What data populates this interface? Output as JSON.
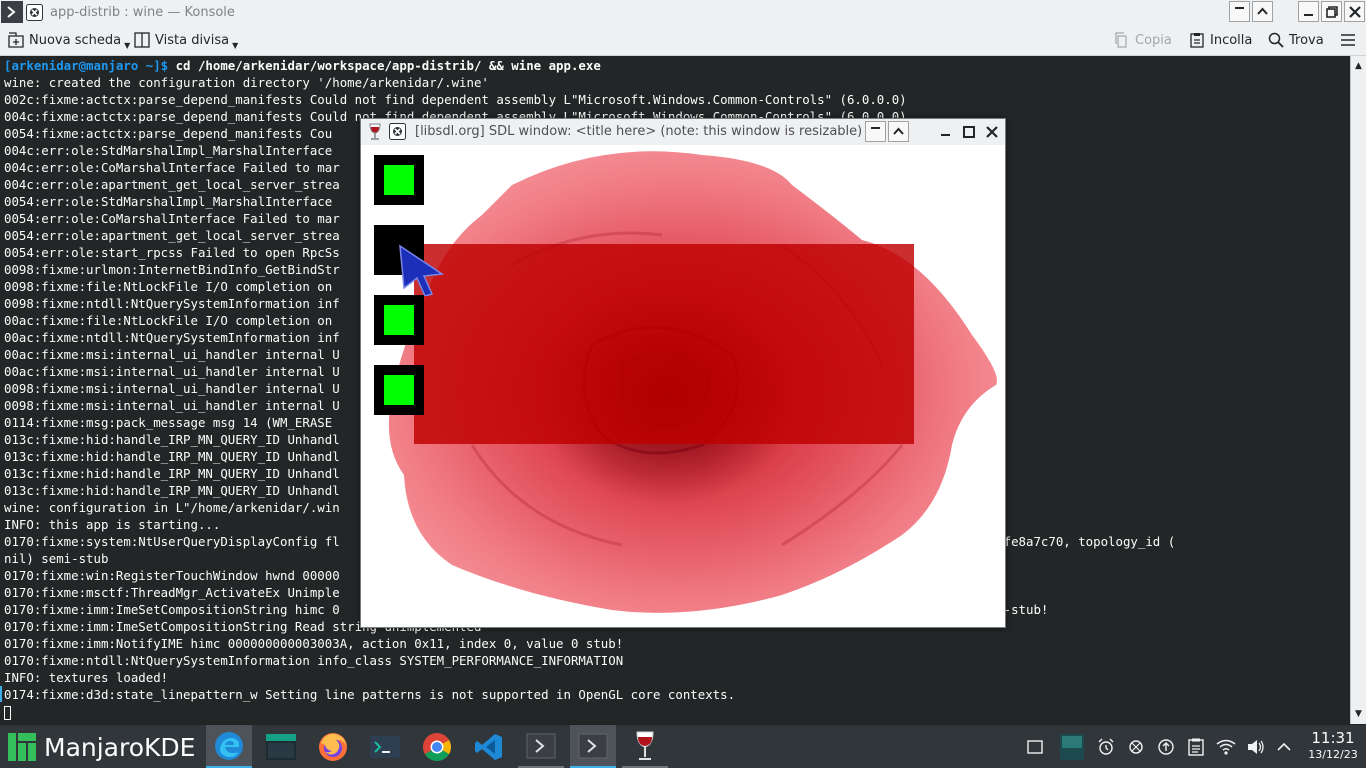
{
  "window": {
    "title": "app-distrib : wine — Konsole"
  },
  "toolbar": {
    "new_tab": "Nuova scheda",
    "split_view": "Vista divisa",
    "copy": "Copia",
    "paste": "Incolla",
    "find": "Trova"
  },
  "terminal": {
    "prompt_user": "[arkenidar@manjaro ~]$",
    "prompt_command": " cd /home/arkenidar/workspace/app-distrib/ && wine app.exe",
    "lines": [
      "wine: created the configuration directory '/home/arkenidar/.wine'",
      "002c:fixme:actctx:parse_depend_manifests Could not find dependent assembly L\"Microsoft.Windows.Common-Controls\" (6.0.0.0)",
      "004c:fixme:actctx:parse_depend_manifests Could not find dependent assembly L\"Microsoft.Windows.Common-Controls\" (6.0.0.0)",
      "0054:fixme:actctx:parse_depend_manifests Cou",
      "004c:err:ole:StdMarshalImpl_MarshalInterface",
      "004c:err:ole:CoMarshalInterface Failed to mar",
      "004c:err:ole:apartment_get_local_server_strea",
      "0054:err:ole:StdMarshalImpl_MarshalInterface",
      "0054:err:ole:CoMarshalInterface Failed to mar",
      "0054:err:ole:apartment_get_local_server_strea",
      "0054:err:ole:start_rpcss Failed to open RpcSs",
      "0098:fixme:urlmon:InternetBindInfo_GetBindStr",
      "0098:fixme:file:NtLockFile I/O completion on",
      "0098:fixme:ntdll:NtQuerySystemInformation inf",
      "00ac:fixme:file:NtLockFile I/O completion on",
      "00ac:fixme:ntdll:NtQuerySystemInformation inf",
      "00ac:fixme:msi:internal_ui_handler internal U",
      "00ac:fixme:msi:internal_ui_handler internal U",
      "0098:fixme:msi:internal_ui_handler internal U",
      "0098:fixme:msi:internal_ui_handler internal U",
      "0114:fixme:msg:pack_message msg 14 (WM_ERASE",
      "013c:fixme:hid:handle_IRP_MN_QUERY_ID Unhandl",
      "013c:fixme:hid:handle_IRP_MN_QUERY_ID Unhandl",
      "013c:fixme:hid:handle_IRP_MN_QUERY_ID Unhandl",
      "013c:fixme:hid:handle_IRP_MN_QUERY_ID Unhandl",
      "wine: configuration in L\"/home/arkenidar/.win",
      "INFO: this app is starting...",
      "0170:fixme:system:NtUserQueryDisplayConfig fl                                                                      ff530, modes 0x7ffffe8a7c70, topology_id (",
      "nil) semi-stub",
      "0170:fixme:win:RegisterTouchWindow hwnd 00000",
      "0170:fixme:msctf:ThreadMgr_ActivateEx Unimple",
      "0170:fixme:imm:ImeSetCompositionString himc 0                                                                      F6, read_len 2 semi-stub!",
      "0170:fixme:imm:ImeSetCompositionString Read string unimplemented",
      "0170:fixme:imm:NotifyIME himc 000000000003003A, action 0x11, index 0, value 0 stub!",
      "0170:fixme:ntdll:NtQuerySystemInformation info_class SYSTEM_PERFORMANCE_INFORMATION",
      "INFO: textures loaded!",
      "0174:fixme:d3d:state_linepattern_w Setting line patterns is not supported in OpenGL core contexts."
    ]
  },
  "sdl_window": {
    "title": "[libsdl.org] SDL window: <title here> (note: this window is resizable)"
  },
  "taskbar": {
    "start_label": "ManjaroKDE",
    "clock_time": "11:31",
    "clock_date": "13/12/23"
  },
  "colors": {
    "terminal_bg": "#232627",
    "prompt": "#1d99f3",
    "accent": "#3daee9",
    "sprite_green": "#00ff00",
    "overlay_red": "#be0000"
  }
}
